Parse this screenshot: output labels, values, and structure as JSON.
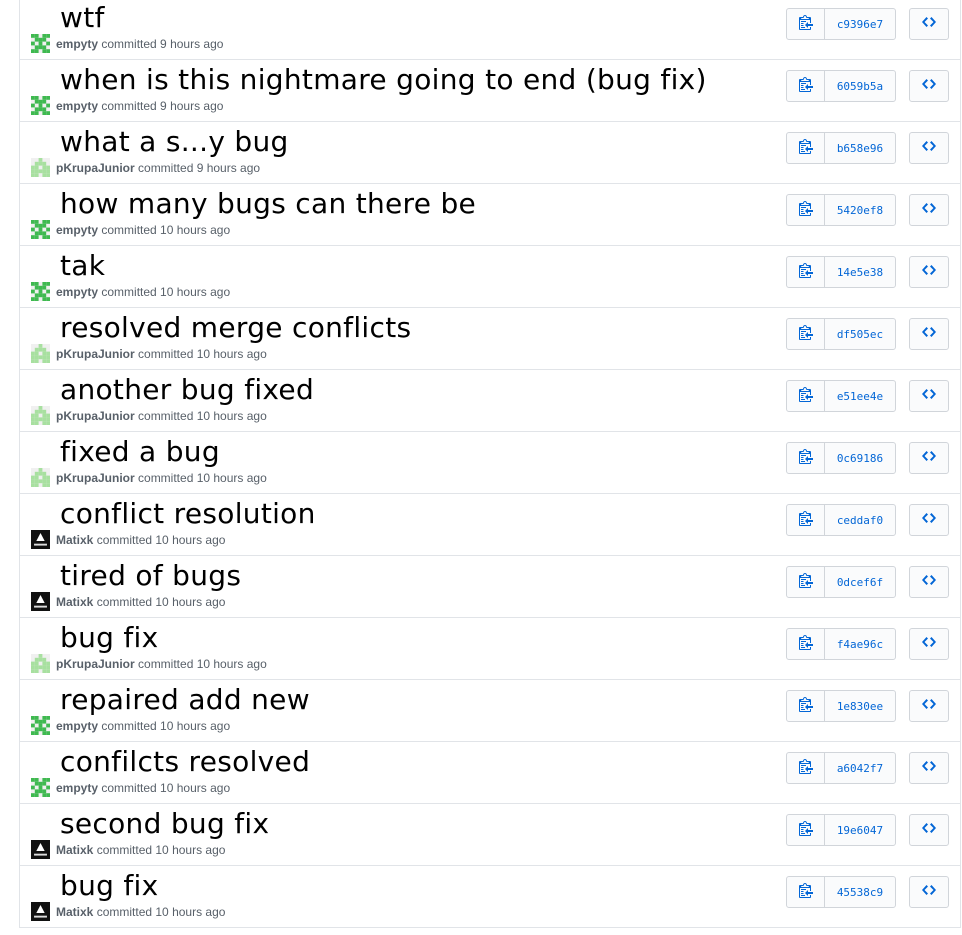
{
  "commits": [
    {
      "title": "wtf",
      "author": "empyty",
      "time": "committed 9 hours ago",
      "sha": "c9396e7",
      "avatar": "green"
    },
    {
      "title": "when is this nightmare going to end (bug fix)",
      "author": "empyty",
      "time": "committed 9 hours ago",
      "sha": "6059b5a",
      "avatar": "green"
    },
    {
      "title": "what a s...y bug",
      "author": "pKrupaJunior",
      "time": "committed 9 hours ago",
      "sha": "b658e96",
      "avatar": "lightgreen"
    },
    {
      "title": "how many bugs can there be",
      "author": "empyty",
      "time": "committed 10 hours ago",
      "sha": "5420ef8",
      "avatar": "green"
    },
    {
      "title": "tak",
      "author": "empyty",
      "time": "committed 10 hours ago",
      "sha": "14e5e38",
      "avatar": "green"
    },
    {
      "title": "resolved merge conflicts",
      "author": "pKrupaJunior",
      "time": "committed 10 hours ago",
      "sha": "df505ec",
      "avatar": "lightgreen"
    },
    {
      "title": "another bug fixed",
      "author": "pKrupaJunior",
      "time": "committed 10 hours ago",
      "sha": "e51ee4e",
      "avatar": "lightgreen"
    },
    {
      "title": "fixed a bug",
      "author": "pKrupaJunior",
      "time": "committed 10 hours ago",
      "sha": "0c69186",
      "avatar": "lightgreen"
    },
    {
      "title": "conflict resolution",
      "author": "Matixk",
      "time": "committed 10 hours ago",
      "sha": "ceddaf0",
      "avatar": "dark"
    },
    {
      "title": "tired of bugs",
      "author": "Matixk",
      "time": "committed 10 hours ago",
      "sha": "0dcef6f",
      "avatar": "dark"
    },
    {
      "title": "bug fix",
      "author": "pKrupaJunior",
      "time": "committed 10 hours ago",
      "sha": "f4ae96c",
      "avatar": "lightgreen"
    },
    {
      "title": "repaired add new",
      "author": "empyty",
      "time": "committed 10 hours ago",
      "sha": "1e830ee",
      "avatar": "green"
    },
    {
      "title": "confilcts resolved",
      "author": "empyty",
      "time": "committed 10 hours ago",
      "sha": "a6042f7",
      "avatar": "green"
    },
    {
      "title": "second bug fix",
      "author": "Matixk",
      "time": "committed 10 hours ago",
      "sha": "19e6047",
      "avatar": "dark"
    },
    {
      "title": "bug fix",
      "author": "Matixk",
      "time": "committed 10 hours ago",
      "sha": "45538c9",
      "avatar": "dark"
    }
  ],
  "colors": {
    "link": "#0366d6",
    "border": "#e1e4e8",
    "meta": "#586069",
    "avatar_green": "#3fb950",
    "avatar_lightgreen": "#a8e0a0",
    "avatar_dark": "#111111"
  },
  "icons": {
    "copy": "clipboard-icon",
    "browse": "code-icon"
  }
}
